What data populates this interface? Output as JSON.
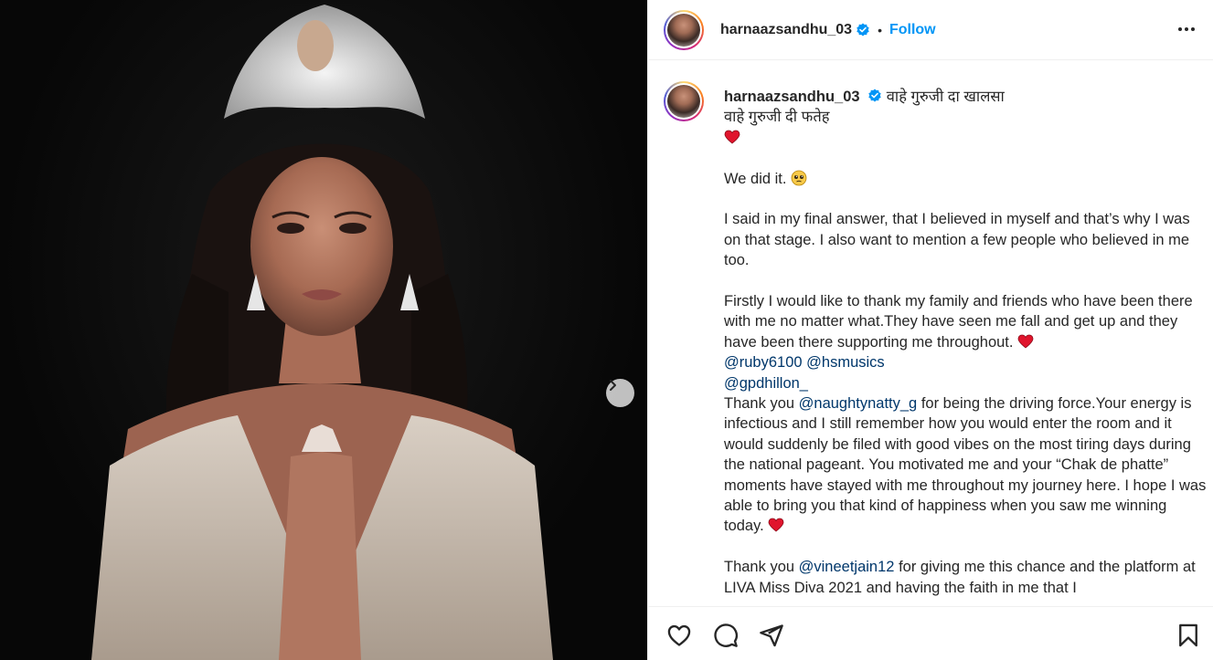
{
  "post": {
    "username": "harnaazsandhu_03",
    "verified": true,
    "separator": "•",
    "follow_label": "Follow"
  },
  "caption": {
    "line1": "वाहे गुरुजी दा खालसा",
    "line2": "वाहे गुरुजी दी फतेह",
    "p_did_it": "We did it.",
    "p_final_answer": "I said in my final answer, that I believed in myself and that’s why I was on that stage. I also want to mention a few people who believed in me too.",
    "p_firstly": "Firstly I would like to thank my family and friends who have been there with me no matter what.They have seen me fall and get up and they have been there supporting me throughout.",
    "mention_ruby": "@ruby6100",
    "mention_hs": "@hsmusics",
    "mention_gp": "@gpdhillon_",
    "thank_you_1": "Thank you",
    "mention_natty": "@naughtynatty_g",
    "p_natty_rest": "for being the driving force.Your energy is infectious and I still remember how you would enter the room and it would suddenly be filed with good vibes on the most tiring days during the national pageant. You motivated me and your “Chak de phatte” moments have stayed with me throughout my journey here. I hope I was able to bring you that kind of happiness when you saw me winning today.",
    "thank_you_2": "Thank you",
    "mention_vineet": "@vineetjain12",
    "p_vineet_rest": "for giving me this chance and the platform at LIVA Miss Diva 2021 and having the faith in me that I"
  },
  "icons": {
    "verified": "verified-badge-icon",
    "more": "more-options-icon",
    "next": "chevron-right-icon",
    "like": "heart-outline-icon",
    "comment": "comment-icon",
    "share": "paper-plane-icon",
    "save": "bookmark-icon",
    "heart_emoji": "red-heart-emoji",
    "pleading_emoji": "pleading-face-emoji"
  },
  "colors": {
    "follow": "#0095f6",
    "mention": "#00376b",
    "verified": "#0095f6",
    "heart": "#e0152d"
  }
}
